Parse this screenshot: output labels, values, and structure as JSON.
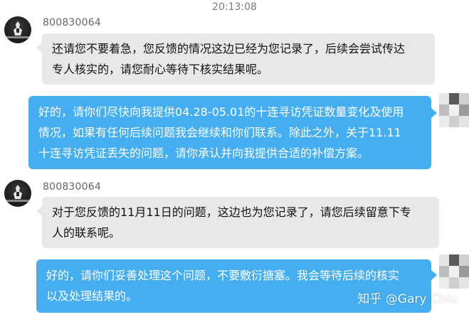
{
  "timestamp": "20:13:08",
  "agent": {
    "name": "800830064",
    "avatar_icon": "game-logo-icon"
  },
  "user": {
    "avatar_icon": "pixelated-avatar-icon"
  },
  "messages": [
    {
      "from": "agent",
      "sender": "800830064",
      "lines": [
        "还请您不要着急，您反馈的情况这边已经为您记录了，后续会尝试传达",
        "专人核实的，请您耐心等待下核实结果呢。"
      ]
    },
    {
      "from": "user",
      "lines": [
        "好的，请你们尽快向我提供04.28-05.01的十连寻访凭证数量变化及使用",
        "情况，如果有任何后续问题我会继续和你们联系。除此之外，关于11.11",
        "十连寻访凭证丢失的问题，请你承认并向我提供合适的补偿方案。"
      ]
    },
    {
      "from": "agent",
      "sender": "800830064",
      "lines": [
        "对于您反馈的11月11日的问题，这边也为您记录了，请您后续留意下专",
        "人的联系呢。"
      ]
    },
    {
      "from": "user",
      "lines": [
        "好的，请你们妥善处理这个问题，不要敷衍搪塞。我会等待后续的核实",
        "以及处理结果的。"
      ]
    }
  ],
  "watermark": "知乎 @Gary Chiu",
  "colors": {
    "bubble_in": "#e8e8e8",
    "bubble_out": "#45aef0",
    "timestamp": "#7a7a7a"
  }
}
